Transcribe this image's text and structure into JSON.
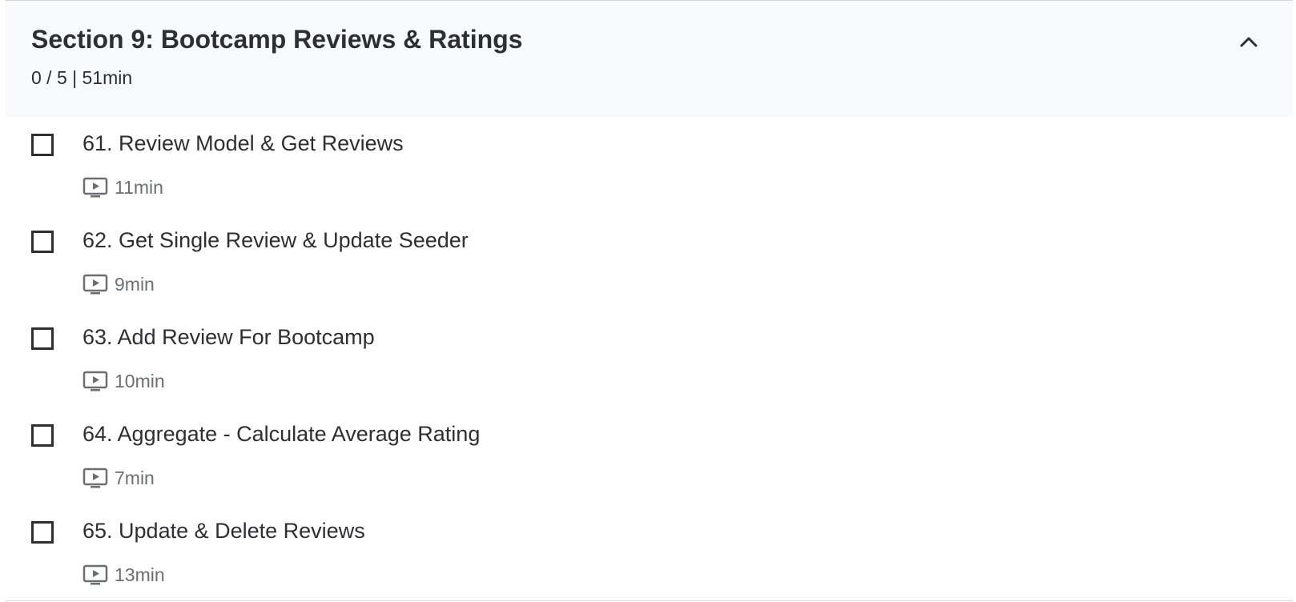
{
  "section": {
    "title": "Section 9: Bootcamp Reviews & Ratings",
    "meta": "0 / 5 | 51min",
    "collapse_icon": "chevron-up-icon",
    "lectures": [
      {
        "title": "61. Review Model & Get Reviews",
        "duration": "11min",
        "completed": false,
        "type_icon": "video-icon"
      },
      {
        "title": "62. Get Single Review & Update Seeder",
        "duration": "9min",
        "completed": false,
        "type_icon": "video-icon"
      },
      {
        "title": "63. Add Review For Bootcamp",
        "duration": "10min",
        "completed": false,
        "type_icon": "video-icon"
      },
      {
        "title": "64. Aggregate - Calculate Average Rating",
        "duration": "7min",
        "completed": false,
        "type_icon": "video-icon"
      },
      {
        "title": "65. Update & Delete Reviews",
        "duration": "13min",
        "completed": false,
        "type_icon": "video-icon"
      }
    ]
  },
  "colors": {
    "header_bg": "#f7f9fa",
    "text": "#2d2f31",
    "muted": "#6a6f73",
    "divider": "#d1d7dc"
  }
}
